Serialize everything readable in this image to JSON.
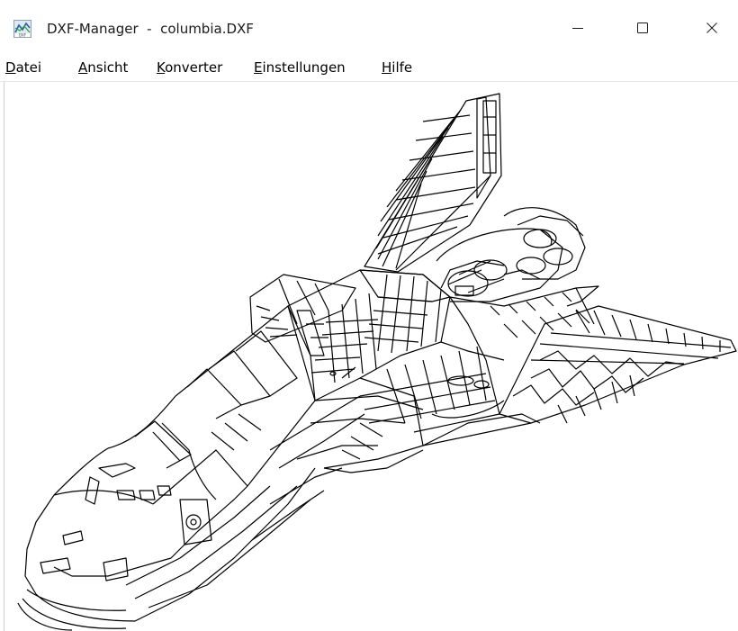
{
  "window": {
    "title": "DXF-Manager  -  columbia.DXF",
    "icon": "dxf-app-icon",
    "controls": {
      "minimize": "minimize-icon",
      "maximize": "maximize-icon",
      "close": "close-icon"
    }
  },
  "menu": {
    "items": [
      {
        "mnemonic": "D",
        "rest": "atei"
      },
      {
        "mnemonic": "A",
        "rest": "nsicht"
      },
      {
        "mnemonic": "K",
        "rest": "onverter"
      },
      {
        "mnemonic": "E",
        "rest": "instellungen"
      },
      {
        "mnemonic": "H",
        "rest": "ilfe"
      }
    ]
  },
  "drawing": {
    "subject": "space-shuttle-wireframe",
    "line_color": "#000000",
    "background": "#ffffff"
  }
}
